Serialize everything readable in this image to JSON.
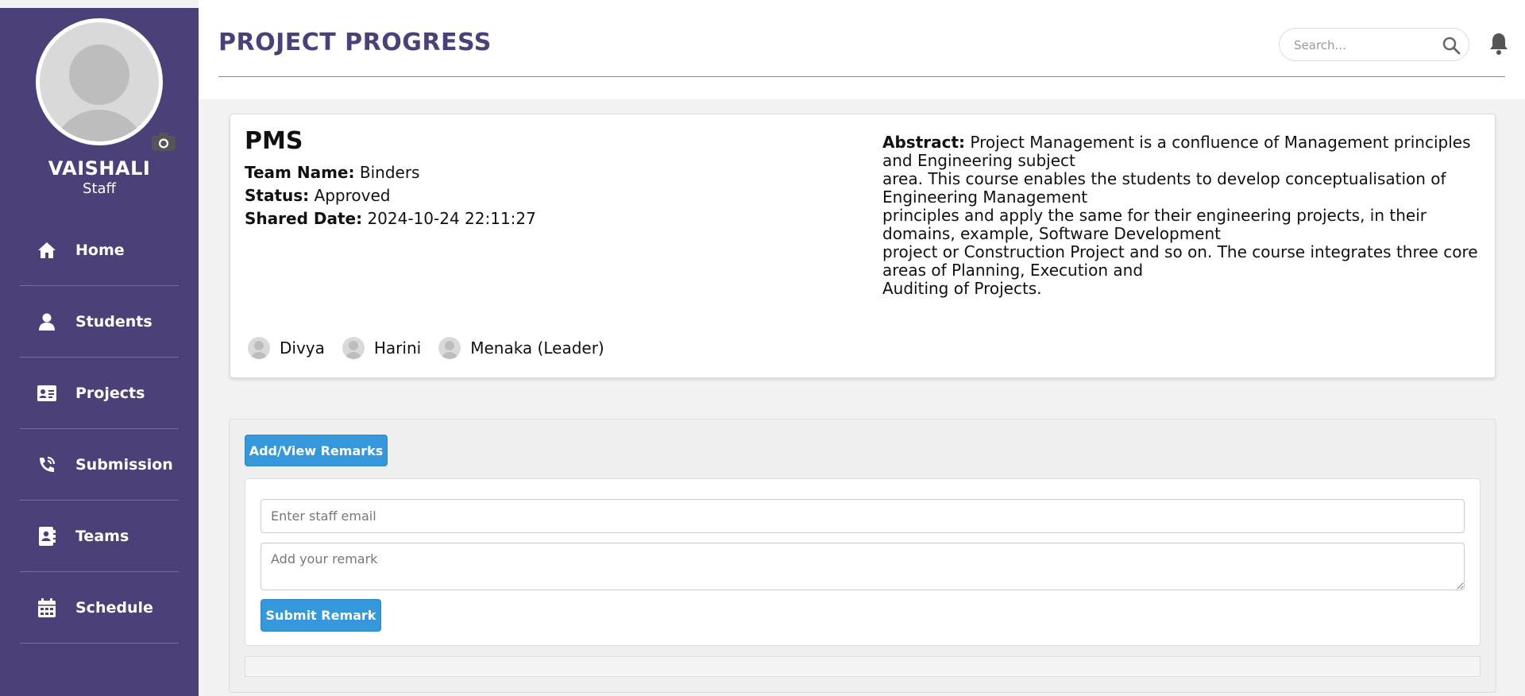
{
  "sidebar": {
    "profile": {
      "name": "VAISHALI",
      "role": "Staff"
    },
    "items": [
      {
        "label": "Home",
        "icon": "home-icon"
      },
      {
        "label": "Students",
        "icon": "user-icon"
      },
      {
        "label": "Projects",
        "icon": "id-card-icon"
      },
      {
        "label": "Submission",
        "icon": "submission-icon"
      },
      {
        "label": "Teams",
        "icon": "contact-book-icon"
      },
      {
        "label": "Schedule",
        "icon": "calendar-icon"
      }
    ]
  },
  "header": {
    "title": "PROJECT PROGRESS",
    "search_placeholder": "Search..."
  },
  "project": {
    "title": "PMS",
    "team_name_label": "Team Name:",
    "team_name": "Binders",
    "status_label": "Status:",
    "status": "Approved",
    "shared_date_label": "Shared Date:",
    "shared_date": "2024-10-24 22:11:27",
    "abstract_label": "Abstract:",
    "abstract_lines": [
      "Project Management is a confluence of Management principles and Engineering subject",
      "area. This course enables the students to develop conceptualisation of Engineering Management",
      "principles and apply the same for their engineering projects, in their domains, example, Software Development",
      "project or Construction Project and so on. The course integrates three core areas of Planning, Execution and",
      "Auditing of Projects."
    ],
    "members": [
      "Divya",
      "Harini",
      "Menaka (Leader)"
    ]
  },
  "remarks": {
    "view_button": "Add/View Remarks",
    "email_placeholder": "Enter staff email",
    "remark_placeholder": "Add your remark",
    "submit_button": "Submit Remark"
  },
  "colors": {
    "sidebar_bg": "#4b4178",
    "title_color": "#4b4178",
    "button_bg": "#3498db"
  }
}
